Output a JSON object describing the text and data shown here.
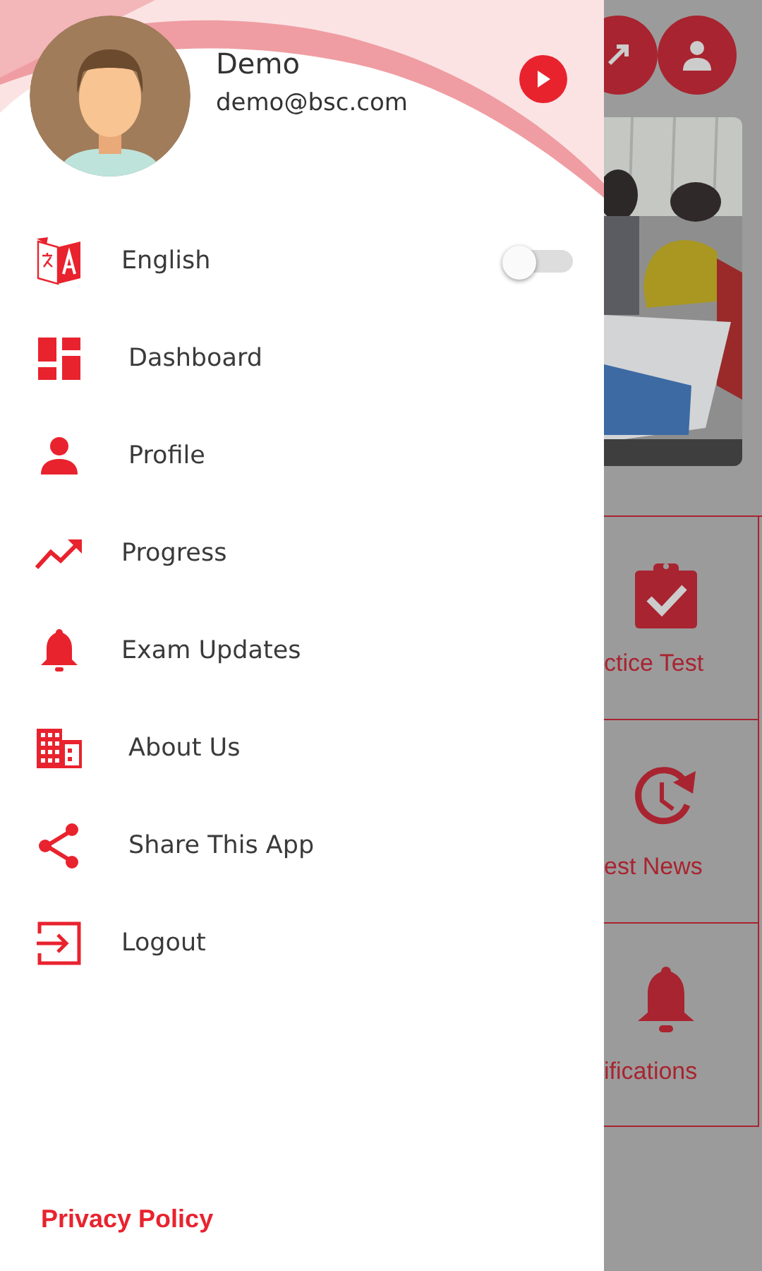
{
  "drawer": {
    "user": {
      "name": "Demo",
      "email": "demo@bsc.com"
    },
    "items": [
      {
        "kind": "toggle",
        "label": "English",
        "on": false
      },
      {
        "kind": "link",
        "label": "Dashboard"
      },
      {
        "kind": "link",
        "label": "Profile"
      },
      {
        "kind": "link",
        "label": "Progress"
      },
      {
        "kind": "link",
        "label": "Exam Updates"
      },
      {
        "kind": "link",
        "label": "About Us"
      },
      {
        "kind": "link",
        "label": "Share This App"
      },
      {
        "kind": "link",
        "label": "Logout"
      }
    ],
    "footer_link": "Privacy Policy"
  },
  "background": {
    "tiles": [
      {
        "label": "ctice Test"
      },
      {
        "label": "est News"
      },
      {
        "label": "ifications"
      }
    ]
  }
}
